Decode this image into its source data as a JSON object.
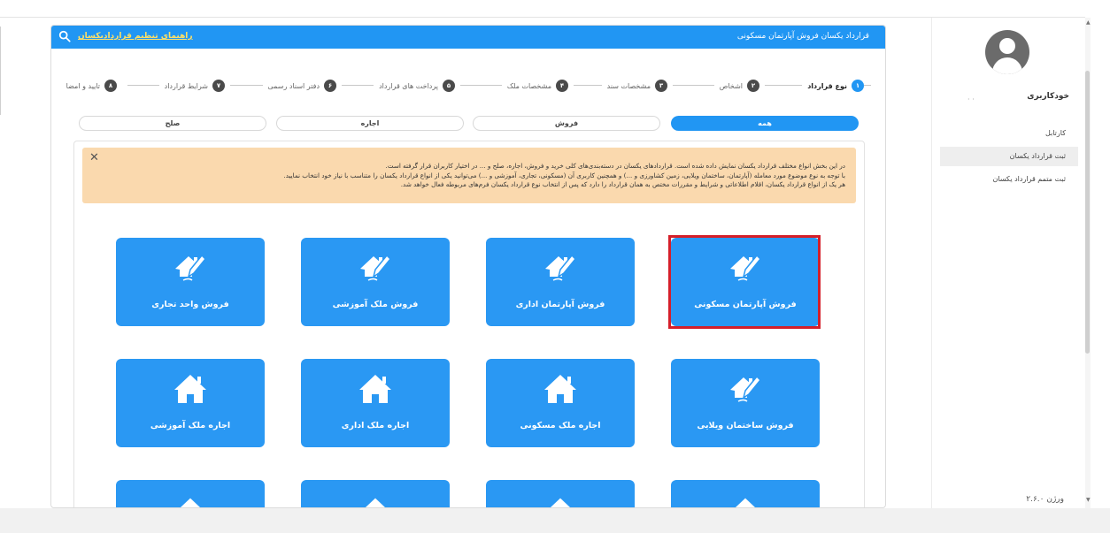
{
  "header": {
    "title": "قرارداد یکسان فروش آپارتمان مسکونی",
    "guide_link": "راهنمای تنظیم قراردادیکسان"
  },
  "sidebar": {
    "user_name": "خودکاربری",
    "user_dots": "·    ·",
    "items": [
      {
        "label": "کارتابل"
      },
      {
        "label": "ثبت قرارداد یکسان"
      },
      {
        "label": "ثبت متمم قرارداد یکسان"
      }
    ],
    "active_index": 1,
    "version": "ورژن ۲.۶.۰"
  },
  "steps": [
    {
      "num": "۱",
      "label": "نوع قرارداد"
    },
    {
      "num": "۲",
      "label": "اشخاص"
    },
    {
      "num": "۳",
      "label": "مشخصات سند"
    },
    {
      "num": "۴",
      "label": "مشخصات ملک"
    },
    {
      "num": "۵",
      "label": "پرداخت های قرارداد"
    },
    {
      "num": "۶",
      "label": "دفتر اسناد رسمی"
    },
    {
      "num": "۷",
      "label": "شرایط قرارداد"
    },
    {
      "num": "۸",
      "label": "تایید و امضا"
    }
  ],
  "tabs": [
    {
      "label": "همه"
    },
    {
      "label": "فروش"
    },
    {
      "label": "اجاره"
    },
    {
      "label": "صلح"
    }
  ],
  "active_tab": 0,
  "alert": {
    "lines": [
      "در این بخش انواع مختلف قرارداد یکسان نمایش داده شده است. قراردادهای یکسان در دسته‌بندی‌های کلی خرید و فروش، اجاره، صلح و ... در اختیار کاربران قرار گرفته است.",
      "با توجه به نوع موضوع مورد معامله (آپارتمان، ساختمان ویلایی، زمین کشاورزی و ...) و همچنین کاربری آن (مسکونی، تجاری، آموزشی و ...) می‌توانید یکی از انواع قرارداد یکسان را متناسب با نیاز خود انتخاب نمایید.",
      "هر یک از انواع قرارداد یکسان، اقلام اطلاعاتی و شرایط و مقررات مختص به همان قرارداد را دارد که پس از انتخاب نوع قرارداد یکسان فرم‌های مربوطه فعال خواهد شد."
    ]
  },
  "tiles": [
    {
      "label": "فروش آپارتمان مسکونی",
      "icon": "house-pen-icon"
    },
    {
      "label": "فروش آپارتمان اداری",
      "icon": "house-pen-icon"
    },
    {
      "label": "فروش ملک آموزشی",
      "icon": "house-pen-icon"
    },
    {
      "label": "فروش واحد تجاری",
      "icon": "house-pen-icon"
    },
    {
      "label": "فروش ساختمان ویلایی",
      "icon": "house-pen-icon"
    },
    {
      "label": "اجاره ملک مسکونی",
      "icon": "house-icon"
    },
    {
      "label": "اجاره ملک اداری",
      "icon": "house-icon"
    },
    {
      "label": "اجاره ملک آموزشی",
      "icon": "house-icon"
    }
  ],
  "selected_tile": 0,
  "colors": {
    "primary": "#2196f3",
    "tile": "#2a98f3",
    "alert_bg": "#fad9ae",
    "highlight": "#d51f2a",
    "step_inactive": "#4a4a4a",
    "link": "#ffe066"
  }
}
